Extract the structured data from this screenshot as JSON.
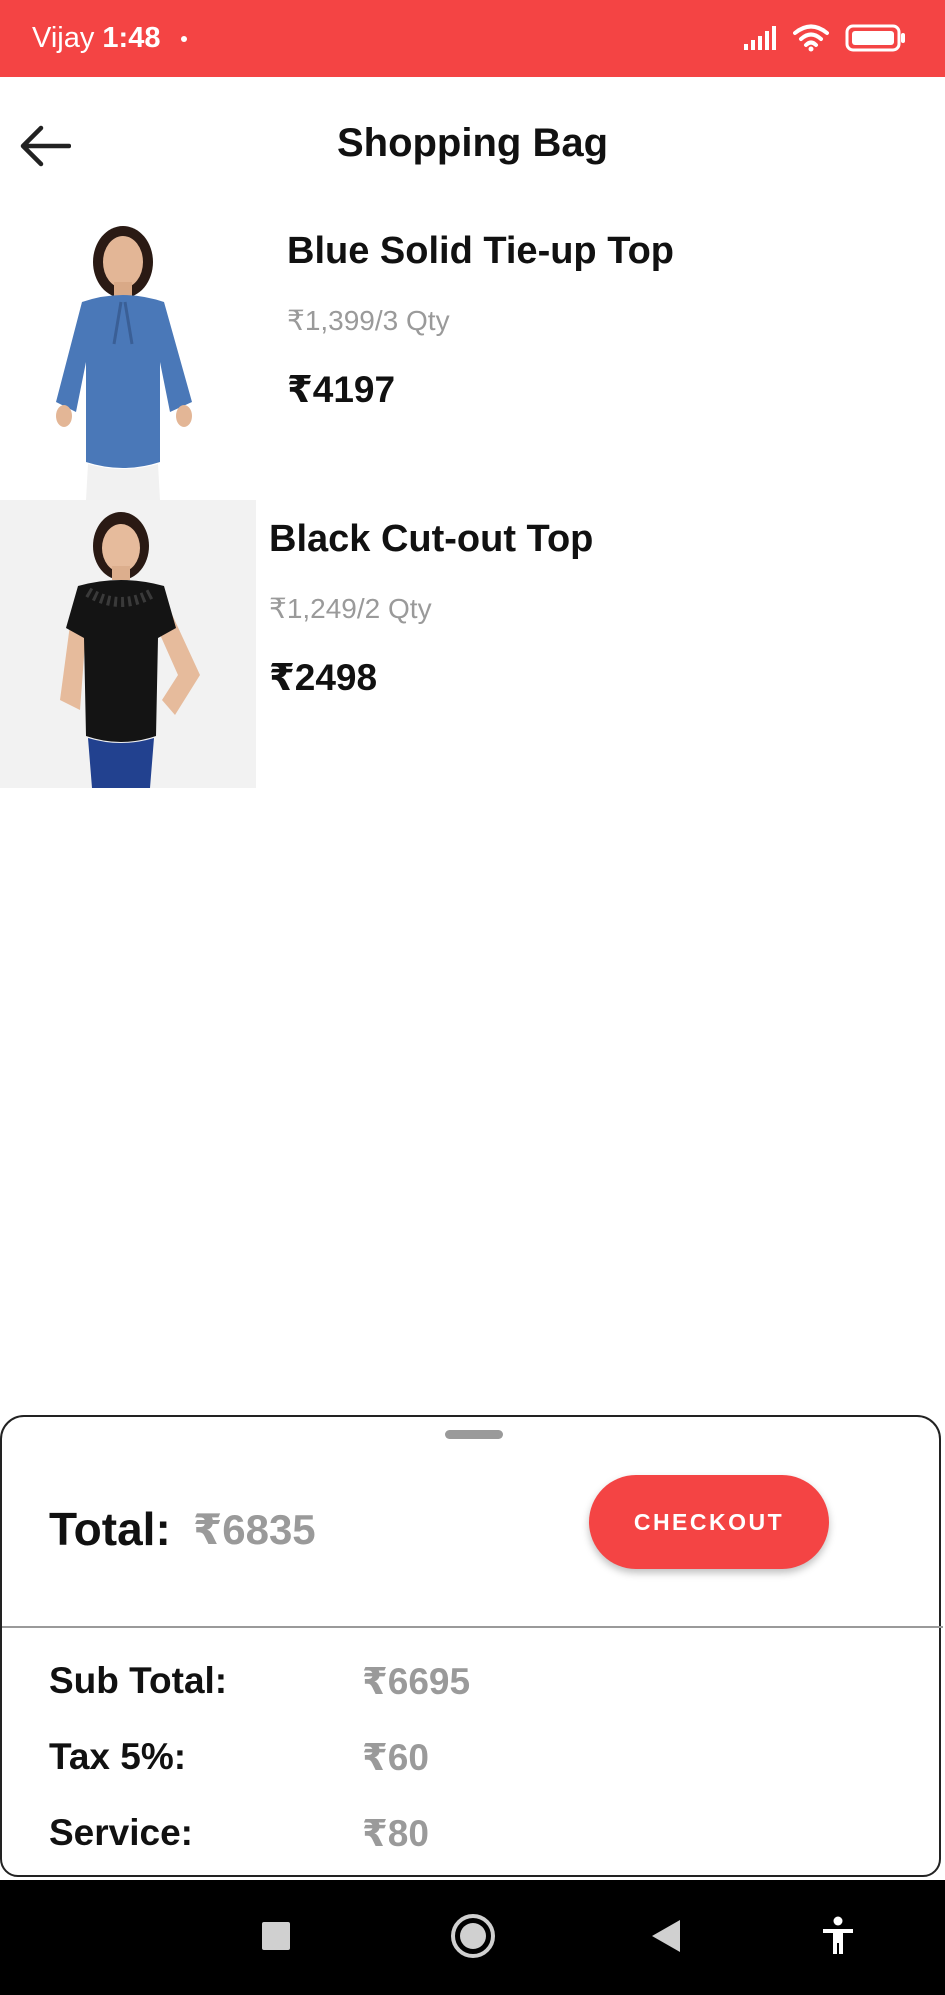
{
  "status_bar": {
    "carrier": "Vijay",
    "time": "1:48"
  },
  "header": {
    "title": "Shopping Bag"
  },
  "cart": {
    "items": [
      {
        "name": "Blue Solid Tie-up Top",
        "unit_price_qty": "₹1,399/3 Qty",
        "line_total": "₹4197"
      },
      {
        "name": "Black Cut-out Top",
        "unit_price_qty": "₹1,249/2 Qty",
        "line_total": "₹2498"
      }
    ]
  },
  "summary": {
    "total_label": "Total:",
    "total_value": "₹6835",
    "checkout_label": "CHECKOUT",
    "rows": [
      {
        "label": "Sub Total:",
        "value": "₹6695"
      },
      {
        "label": "Tax 5%:",
        "value": "₹60"
      },
      {
        "label": "Service:",
        "value": "₹80"
      }
    ]
  },
  "colors": {
    "accent": "#f44444",
    "muted_text": "#9a9a9a"
  }
}
